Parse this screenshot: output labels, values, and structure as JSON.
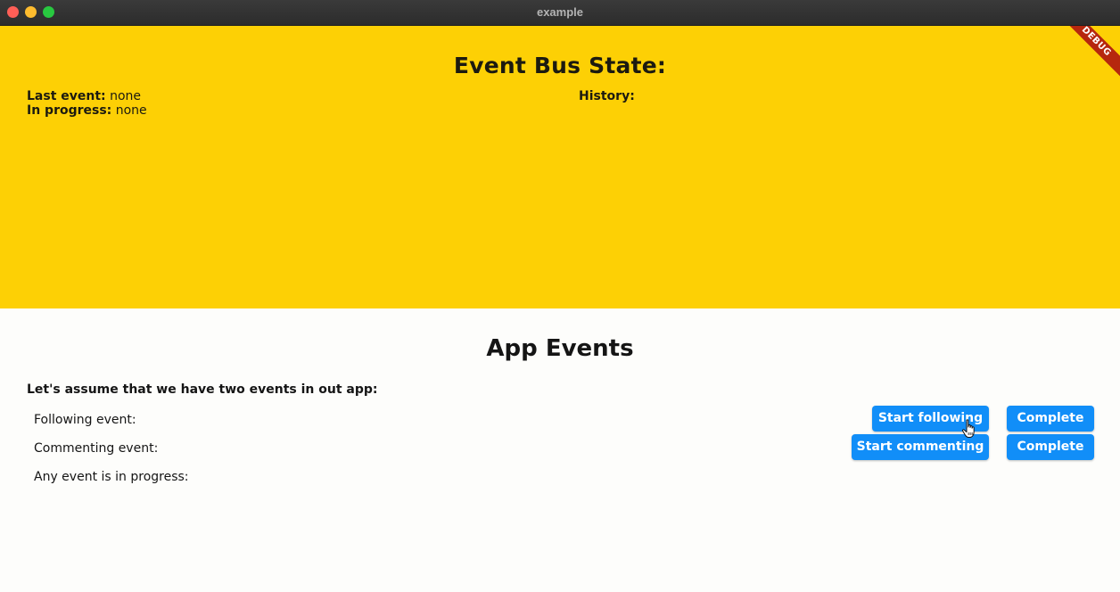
{
  "window": {
    "title": "example"
  },
  "state_panel": {
    "title": "Event Bus State:",
    "last_event_label": "Last event:",
    "last_event_value": "none",
    "in_progress_label": "In progress:",
    "in_progress_value": "none",
    "history_label": "History:",
    "debug_banner": "DEBUG",
    "background_color": "#fdd005"
  },
  "events_panel": {
    "title": "App Events",
    "intro": "Let's assume that we have two events in out app:",
    "rows": [
      {
        "label": "Following event:"
      },
      {
        "label": "Commenting event:"
      },
      {
        "label": "Any event is in progress:"
      }
    ],
    "buttons": {
      "start_following": "Start following",
      "complete_following": "Complete",
      "start_commenting": "Start commenting",
      "complete_commenting": "Complete"
    },
    "button_color": "#118ef8"
  },
  "icons": {
    "cursor": "hand-pointer-icon"
  }
}
